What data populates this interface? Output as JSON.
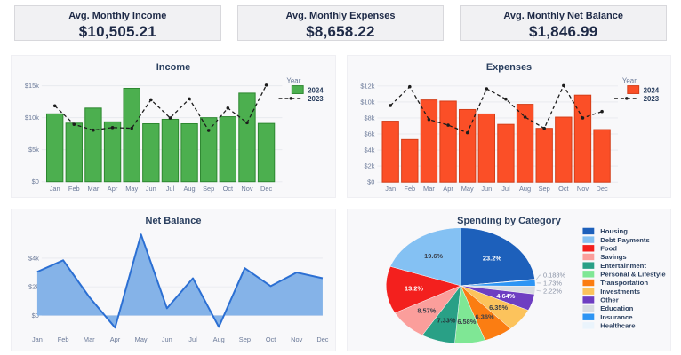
{
  "kpi_cards": [
    {
      "label": "Avg. Monthly Income",
      "value": "$10,505.21"
    },
    {
      "label": "Avg. Monthly Expenses",
      "value": "$8,658.22"
    },
    {
      "label": "Avg. Monthly Net Balance",
      "value": "$1,846.99"
    }
  ],
  "chart_data": [
    {
      "type": "bar",
      "title": "Income",
      "categories": [
        "Jan",
        "Feb",
        "Mar",
        "Apr",
        "May",
        "Jun",
        "Jul",
        "Aug",
        "Sep",
        "Oct",
        "Nov",
        "Dec"
      ],
      "series": [
        {
          "name": "2024",
          "type": "bar",
          "color": "#4caf4f",
          "border_color": "#2c872f",
          "values": [
            10600,
            9150,
            11500,
            9350,
            14600,
            9050,
            9750,
            9050,
            10000,
            10150,
            13850,
            9100
          ]
        },
        {
          "name": "2023",
          "type": "line",
          "color": "#1c1c1c",
          "dash": true,
          "values": [
            11850,
            8950,
            8050,
            8450,
            8350,
            12800,
            9950,
            12950,
            8000,
            11500,
            9200,
            15100
          ]
        }
      ],
      "xlabel": "",
      "ylabel": "",
      "ytick_values": [
        0,
        5000,
        10000,
        15000
      ],
      "ytick_labels": [
        "$0",
        "$5k",
        "$10k",
        "$15k"
      ],
      "ylim": [
        0,
        16100
      ],
      "grid": true,
      "legend_title": "Year",
      "legend_position": "right"
    },
    {
      "type": "bar",
      "title": "Expenses",
      "categories": [
        "Jan",
        "Feb",
        "Mar",
        "Apr",
        "May",
        "Jun",
        "Jul",
        "Aug",
        "Sep",
        "Oct",
        "Nov",
        "Dec"
      ],
      "series": [
        {
          "name": "2024",
          "type": "bar",
          "color": "#fb4f27",
          "border_color": "#d43d18",
          "values": [
            7600,
            5300,
            10250,
            10100,
            9050,
            8500,
            7200,
            9700,
            6700,
            8100,
            10850,
            6550
          ]
        },
        {
          "name": "2023",
          "type": "line",
          "color": "#1c1c1c",
          "dash": true,
          "values": [
            9550,
            11900,
            7800,
            7100,
            6150,
            11650,
            10350,
            8100,
            6700,
            12050,
            8000,
            8800
          ]
        }
      ],
      "xlabel": "",
      "ylabel": "",
      "ytick_values": [
        0,
        2000,
        4000,
        6000,
        8000,
        10000,
        12000
      ],
      "ytick_labels": [
        "$0",
        "$2k",
        "$4k",
        "$6k",
        "$8k",
        "$10k",
        "$12k"
      ],
      "ylim": [
        0,
        12900
      ],
      "grid": true,
      "legend_title": "Year",
      "legend_position": "right"
    },
    {
      "type": "area",
      "title": "Net Balance",
      "categories": [
        "Jan",
        "Feb",
        "Mar",
        "Apr",
        "May",
        "Jun",
        "Jul",
        "Aug",
        "Sep",
        "Oct",
        "Nov",
        "Dec"
      ],
      "series": [
        {
          "name": "Net Balance",
          "type": "area",
          "color": "#2b6fd3",
          "fill_color": "#85b3e8",
          "values": [
            3050,
            3850,
            1300,
            -850,
            5650,
            500,
            2600,
            -800,
            3300,
            2050,
            3000,
            2600
          ]
        }
      ],
      "xlabel": "",
      "ylabel": "",
      "ytick_values": [
        0,
        2000,
        4000
      ],
      "ytick_labels": [
        "$0",
        "$2k",
        "$4k"
      ],
      "ylim": [
        -1150,
        5900
      ],
      "grid": true
    },
    {
      "type": "pie",
      "title": "Spending by Category",
      "slices": [
        {
          "label": "Housing",
          "value": 23.2,
          "pct_label": "23.2%",
          "color": "#1d60bb",
          "label_inside": true,
          "label_color": "#ffffff"
        },
        {
          "label": "Debt Payments",
          "value": 19.6,
          "pct_label": "19.6%",
          "color": "#84c1f3",
          "label_inside": true,
          "label_color": "#3a3f4a"
        },
        {
          "label": "Food",
          "value": 13.2,
          "pct_label": "13.2%",
          "color": "#f3201e",
          "label_inside": true,
          "label_color": "#ffffff"
        },
        {
          "label": "Savings",
          "value": 8.57,
          "pct_label": "8.57%",
          "color": "#fb9e9b",
          "label_inside": true,
          "label_color": "#3a3f4a"
        },
        {
          "label": "Entertainment",
          "value": 7.33,
          "pct_label": "7.33%",
          "color": "#29a086",
          "label_inside": true,
          "label_color": "#263238"
        },
        {
          "label": "Personal & Lifestyle",
          "value": 6.58,
          "pct_label": "6.58%",
          "color": "#7fe795",
          "label_inside": true,
          "label_color": "#3a3f4a"
        },
        {
          "label": "Transportation",
          "value": 6.36,
          "pct_label": "6.36%",
          "color": "#fb7d12",
          "label_inside": true,
          "label_color": "#3a3f4a"
        },
        {
          "label": "Investments",
          "value": 6.35,
          "pct_label": "6.35%",
          "color": "#fcc35c",
          "label_inside": true,
          "label_color": "#3a3f4a"
        },
        {
          "label": "Other",
          "value": 4.64,
          "pct_label": "4.64%",
          "color": "#6e3ec2",
          "label_inside": true,
          "label_color": "#ffffff"
        },
        {
          "label": "Education",
          "value": 2.22,
          "pct_label": "2.22%",
          "color": "#d8dce2",
          "label_inside": false,
          "label_color": "#8a93a6"
        },
        {
          "label": "Insurance",
          "value": 1.73,
          "pct_label": "1.73%",
          "color": "#2e95f4",
          "label_inside": false,
          "label_color": "#8a93a6"
        },
        {
          "label": "Healthcare",
          "value": 0.188,
          "pct_label": "0.188%",
          "color": "#eaf4fc",
          "label_inside": false,
          "label_color": "#8a93a6"
        }
      ],
      "draw_order": [
        0,
        11,
        10,
        9,
        8,
        7,
        6,
        5,
        4,
        3,
        2,
        1
      ],
      "start_angle_deg": 0,
      "direction": "clockwise",
      "legend_position": "right"
    }
  ]
}
